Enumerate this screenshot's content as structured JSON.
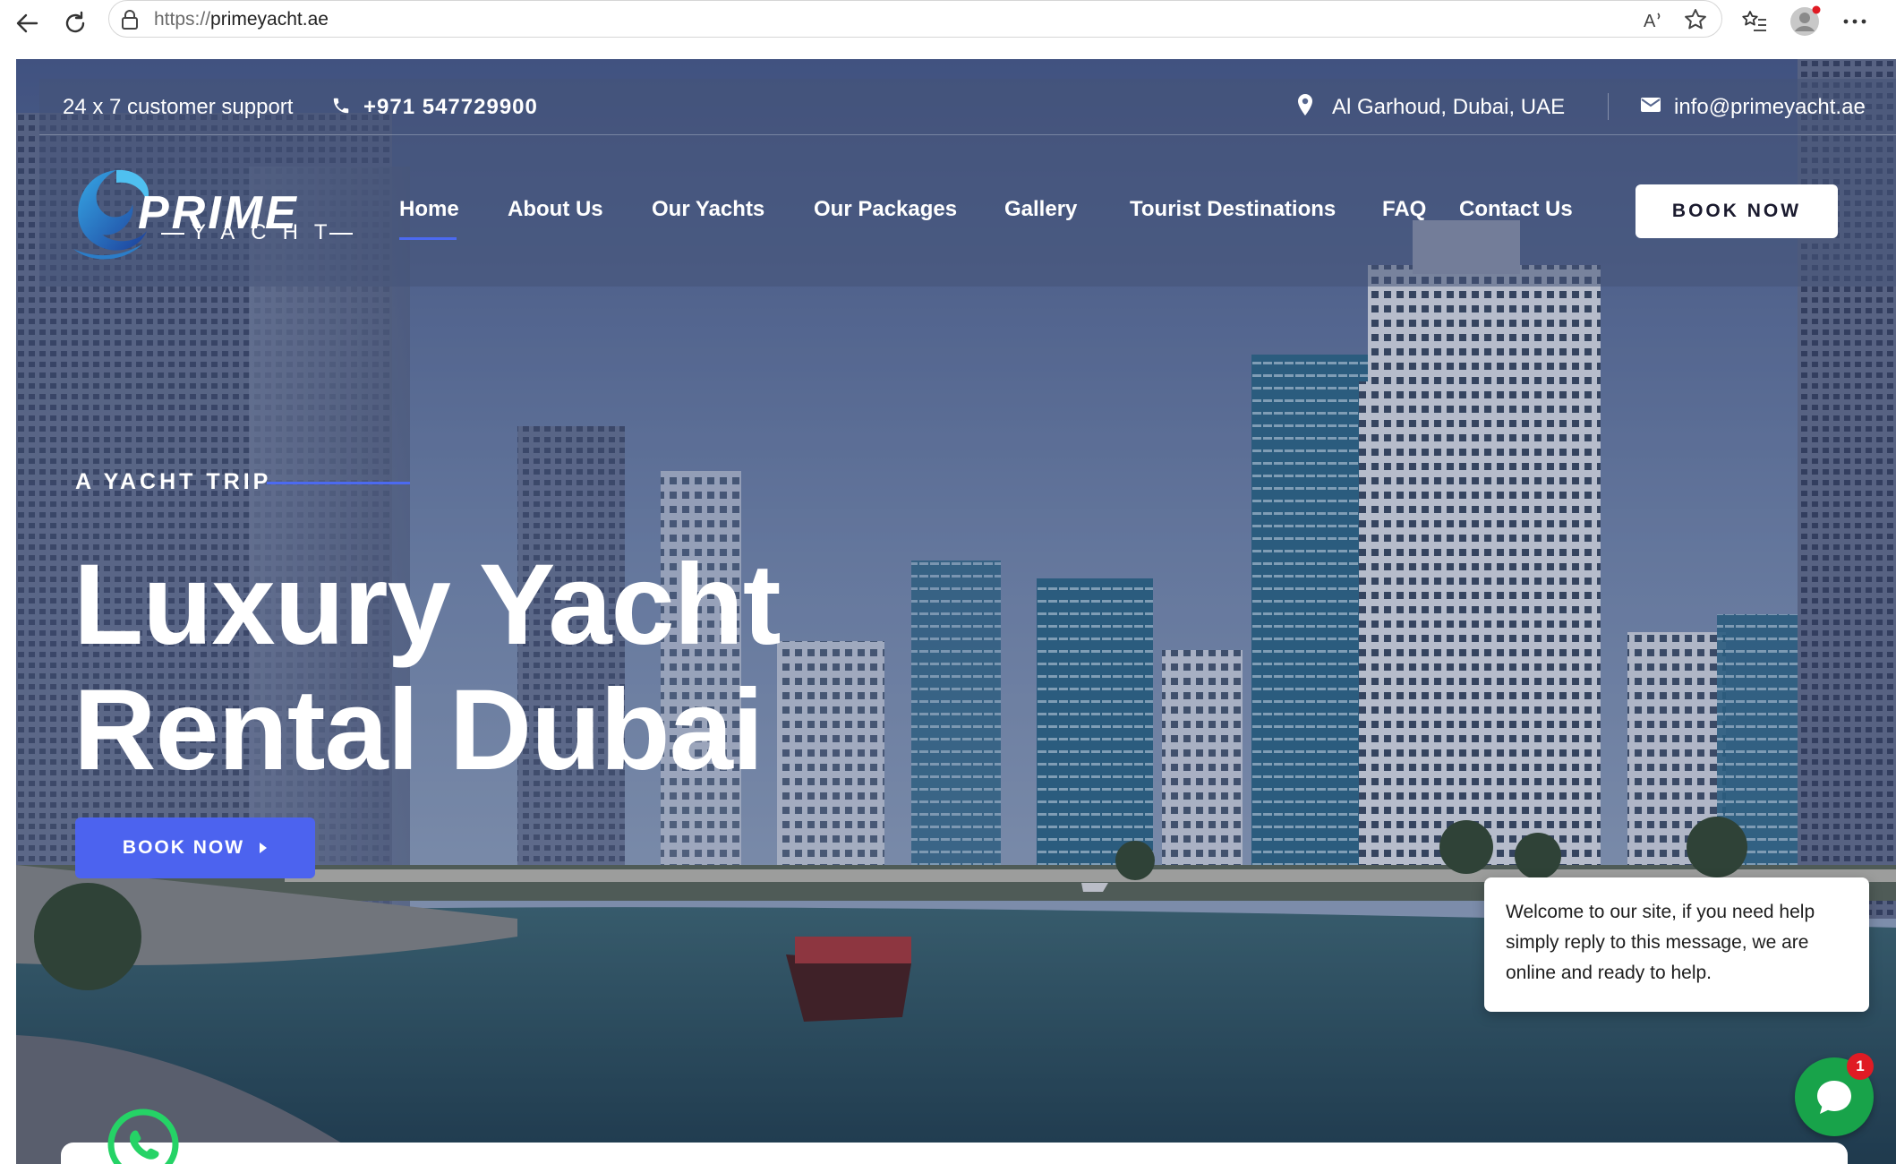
{
  "browser": {
    "url_scheme": "https://",
    "url_host": "primeyacht.ae",
    "icons": [
      "back-arrow-icon",
      "refresh-icon",
      "lock-icon",
      "read-aloud-icon",
      "favorite-star-icon",
      "favorites-list-icon",
      "profile-avatar-icon",
      "more-menu-icon"
    ]
  },
  "topbar": {
    "support_text": "24 x 7 customer support",
    "phone": "+971 547729900",
    "location": "Al Garhoud, Dubai, UAE",
    "email": "info@primeyacht.ae"
  },
  "logo": {
    "word": "PRIME",
    "subword": "YACHT"
  },
  "nav": {
    "items": [
      {
        "label": "Home",
        "active": true
      },
      {
        "label": "About Us"
      },
      {
        "label": "Our Yachts"
      },
      {
        "label": "Our Packages"
      },
      {
        "label": "Gallery"
      },
      {
        "label": "Tourist Destinations"
      },
      {
        "label": "FAQ"
      },
      {
        "label": "Contact Us"
      }
    ],
    "book_label": "BOOK NOW"
  },
  "hero": {
    "eyebrow": "A YACHT TRIP",
    "title_line1": "Luxury Yacht",
    "title_line2": "Rental Dubai",
    "button_label": "BOOK NOW"
  },
  "chat": {
    "message": "Welcome to our site, if you need help simply reply to this message, we are online and ready to help.",
    "badge_count": "1"
  },
  "colors": {
    "accent": "#4c63ef",
    "chat_green": "#18a34a",
    "badge_red": "#e01b24"
  }
}
